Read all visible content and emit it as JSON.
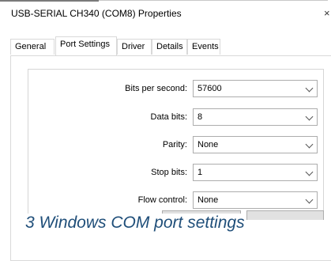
{
  "window": {
    "title": "USB-SERIAL CH340 (COM8) Properties",
    "close_glyph": "×"
  },
  "tabs": [
    {
      "label": "General"
    },
    {
      "label": "Port Settings"
    },
    {
      "label": "Driver"
    },
    {
      "label": "Details"
    },
    {
      "label": "Events"
    }
  ],
  "settings": {
    "bits_per_second": {
      "label": "Bits per second:",
      "value": "57600"
    },
    "data_bits": {
      "label": "Data bits:",
      "value": "8"
    },
    "parity": {
      "label": "Parity:",
      "value": "None"
    },
    "stop_bits": {
      "label": "Stop bits:",
      "value": "1"
    },
    "flow_control": {
      "label": "Flow control:",
      "value": "None"
    }
  },
  "caption": "3  Windows COM port settings",
  "colors": {
    "caption": "#1f4e79",
    "border": "#adadad"
  }
}
